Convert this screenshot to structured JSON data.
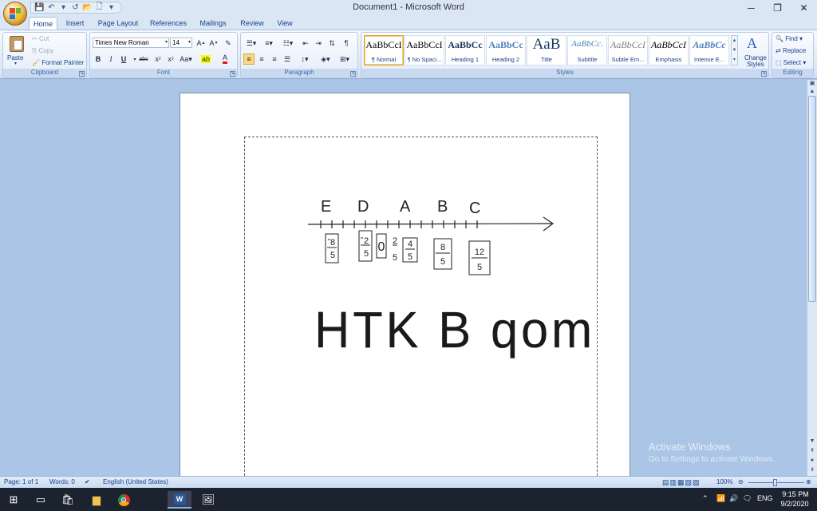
{
  "window": {
    "title": "Document1 - Microsoft Word",
    "minimize": "─",
    "restore": "❐",
    "close": "✕"
  },
  "qat": {
    "save": "💾",
    "undo": "↶",
    "redo": "↺",
    "open": "📂",
    "new": "🗋",
    "more": "▾"
  },
  "tabs": [
    "Home",
    "Insert",
    "Page Layout",
    "References",
    "Mailings",
    "Review",
    "View"
  ],
  "ribbon": {
    "clipboard": {
      "label": "Clipboard",
      "paste": "Paste",
      "cut": "Cut",
      "copy": "Copy",
      "format_painter": "Format Painter"
    },
    "font": {
      "label": "Font",
      "font_name": "Times New Roman",
      "font_size": "14"
    },
    "paragraph": {
      "label": "Paragraph"
    },
    "styles": {
      "label": "Styles",
      "items": [
        {
          "sample": "AaBbCcI",
          "name": "¶ Normal"
        },
        {
          "sample": "AaBbCcI",
          "name": "¶ No Spaci..."
        },
        {
          "sample": "AaBbCc",
          "name": "Heading 1"
        },
        {
          "sample": "AaBbCc",
          "name": "Heading 2"
        },
        {
          "sample": "AaB",
          "name": "Title"
        },
        {
          "sample": "AaBbCc.",
          "name": "Subtitle"
        },
        {
          "sample": "AaBbCcI",
          "name": "Subtle Em..."
        },
        {
          "sample": "AaBbCcI",
          "name": "Emphasis"
        },
        {
          "sample": "AaBbCc",
          "name": "Intense E..."
        }
      ],
      "change_styles": "Change Styles"
    },
    "editing": {
      "label": "Editing",
      "find": "Find",
      "replace": "Replace",
      "select": "Select"
    }
  },
  "document": {
    "number_line_labels": [
      "E",
      "D",
      "A",
      "B",
      "C"
    ],
    "fractions": [
      {
        "num": "8",
        "den": "5",
        "neg": true
      },
      {
        "num": "2",
        "den": "5",
        "neg": true
      },
      {
        "num": "0",
        "den": "",
        "neg": false
      },
      {
        "num": "2",
        "den": "5",
        "neg": false
      },
      {
        "num": "4",
        "den": "5",
        "neg": false
      },
      {
        "num": "8",
        "den": "5",
        "neg": false
      },
      {
        "num": "12",
        "den": "5",
        "neg": false
      }
    ],
    "handwriting": "HTK B qom"
  },
  "watermark": {
    "line1": "Activate Windows",
    "line2": "Go to Settings to activate Windows."
  },
  "status": {
    "page": "Page: 1 of 1",
    "words": "Words: 0",
    "language": "English (United States)",
    "zoom": "100%"
  },
  "taskbar": {
    "lang": "ENG",
    "time": "9:15 PM",
    "date": "9/2/2020"
  }
}
